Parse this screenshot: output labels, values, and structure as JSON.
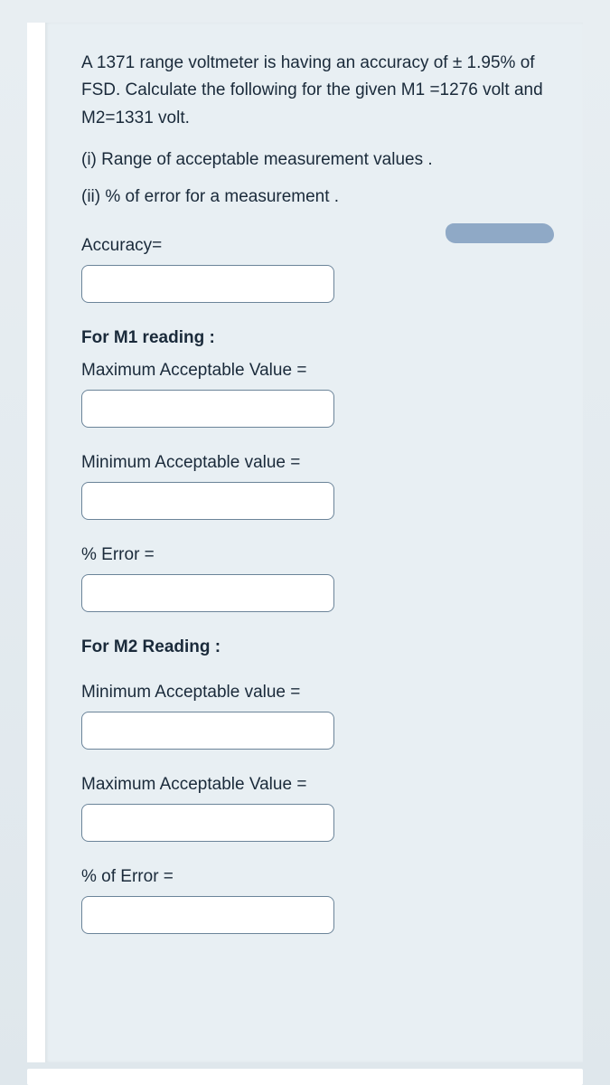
{
  "problem": {
    "statement": "A 1371 range  voltmeter  is having an accuracy of ± 1.95% of FSD. Calculate the following  for the given M1 =1276 volt and M2=1331 volt.",
    "point_i": "(i) Range of acceptable measurement values .",
    "point_ii": "(ii)   % of error for a measurement ."
  },
  "fields": {
    "accuracy_label": "Accuracy=",
    "m1_heading": "For M1 reading :",
    "m1_max_label": "Maximum Acceptable Value =",
    "m1_min_label": "Minimum Acceptable value =",
    "m1_error_label": "% Error =",
    "m2_heading": "For M2 Reading :",
    "m2_min_label": "Minimum Acceptable value =",
    "m2_max_label": "Maximum Acceptable Value =",
    "m2_error_label": "% of Error ="
  }
}
